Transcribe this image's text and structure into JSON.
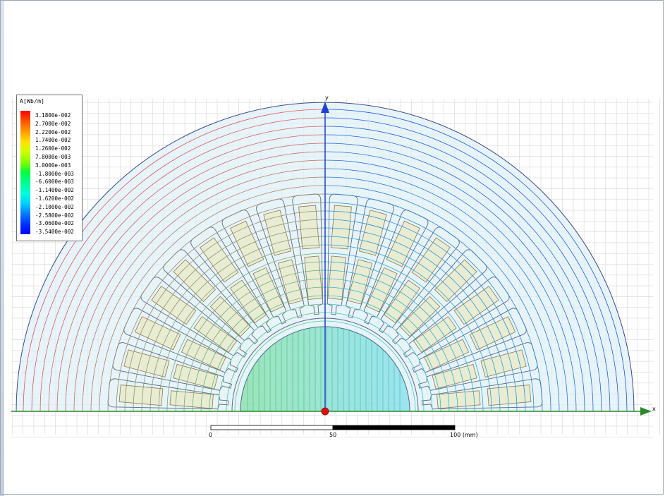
{
  "legend": {
    "title": "A[Wb/m]",
    "values": [
      "3.1800e-002",
      "2.7000e-002",
      "2.2200e-002",
      "1.7400e-002",
      "1.2600e-002",
      "7.8000e-003",
      "3.0000e-003",
      "-1.8000e-003",
      "-6.6000e-003",
      "-1.1400e-002",
      "-1.6200e-002",
      "-2.1000e-002",
      "-2.5800e-002",
      "-3.0600e-002",
      "-3.5400e-002"
    ]
  },
  "axes": {
    "x_label": "x",
    "y_label": "y"
  },
  "scale_bar": {
    "start": "0",
    "mid": "50",
    "end": "100 (mm)"
  },
  "colors": {
    "grid": "#dcdcdc",
    "model_fill": "#dff0f7",
    "axis": "#1f3fd6",
    "x_axis": "#2a8a2a",
    "origin": "#dd1010"
  },
  "model": {
    "stator_slots": 18
  }
}
